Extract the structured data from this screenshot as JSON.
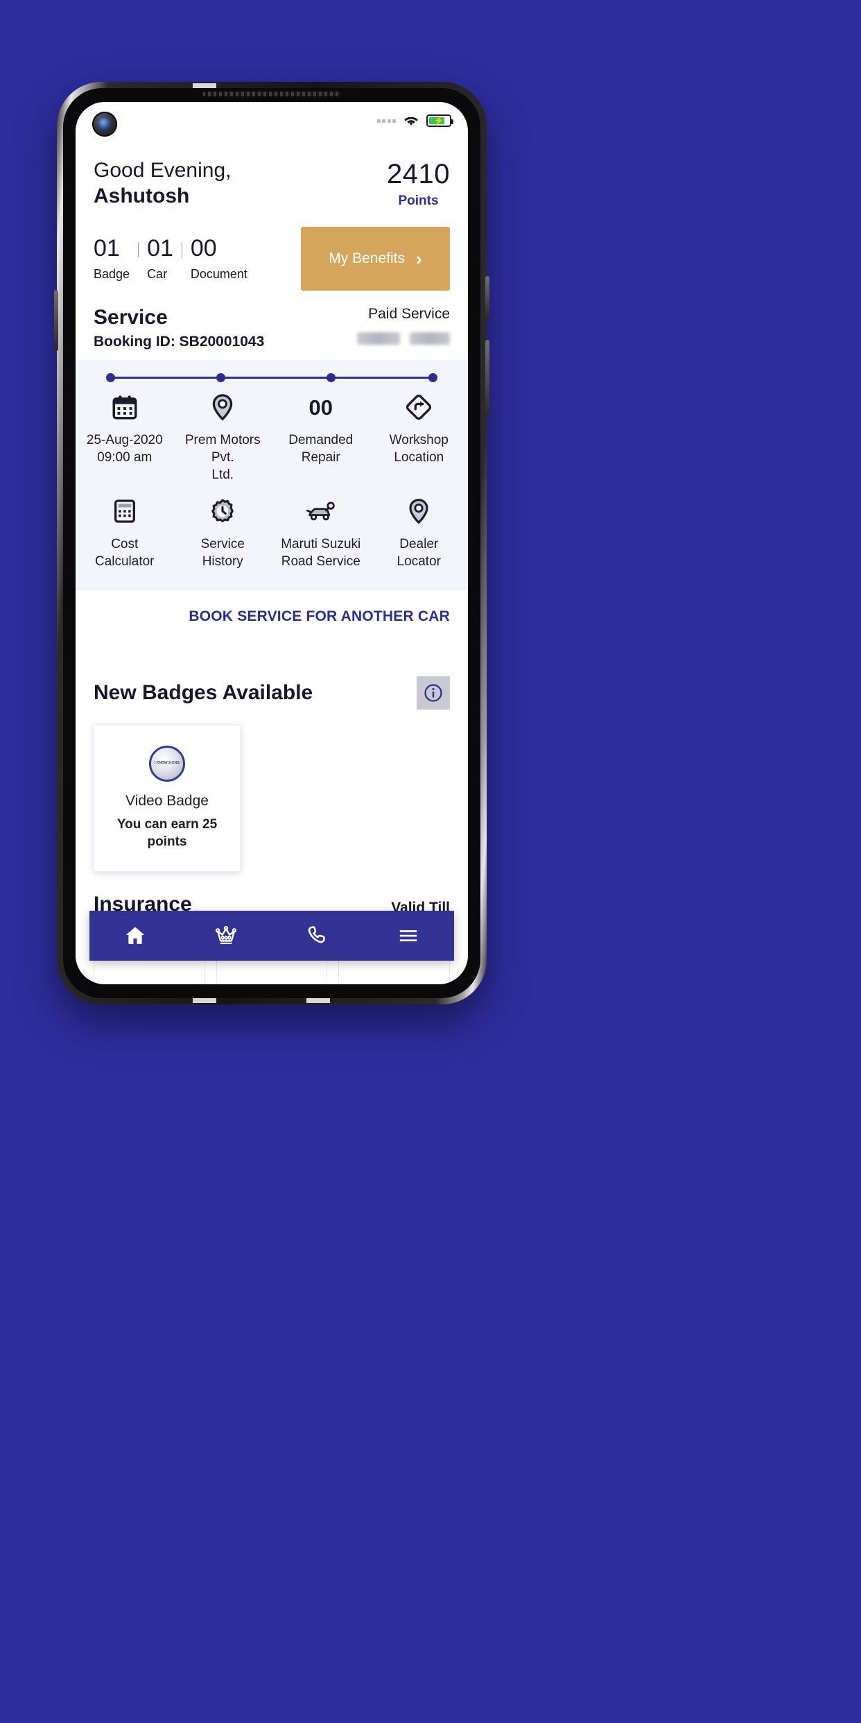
{
  "statusbar": {
    "signal_icon": "signal-dots-icon",
    "wifi_icon": "wifi-icon",
    "battery_icon": "battery-charging-icon"
  },
  "header": {
    "greeting": "Good Evening,",
    "user_name": "Ashutosh",
    "points_value": "2410",
    "points_label": "Points"
  },
  "stats": {
    "items": [
      {
        "value": "01",
        "label": "Badge"
      },
      {
        "value": "01",
        "label": "Car"
      },
      {
        "value": "00",
        "label": "Document"
      }
    ],
    "benefits_label": "My Benefits",
    "benefits_chevron": "chevron-right-icon"
  },
  "service": {
    "title": "Service",
    "booking_id": "Booking ID: SB20001043",
    "paid_label": "Paid Service",
    "timeline": [
      {
        "icon": "calendar-icon",
        "line1": "25-Aug-2020",
        "line2": "09:00 am",
        "value": ""
      },
      {
        "icon": "location-pin-icon",
        "line1": "Prem Motors Pvt.",
        "line2": "Ltd.",
        "value": ""
      },
      {
        "icon": "count-number",
        "line1": "Demanded",
        "line2": "Repair",
        "value": "00"
      },
      {
        "icon": "workshop-direction-icon",
        "line1": "Workshop",
        "line2": "Location",
        "value": ""
      }
    ],
    "actions": [
      {
        "icon": "calculator-icon",
        "line1": "Cost",
        "line2": "Calculator"
      },
      {
        "icon": "gear-clock-icon",
        "line1": "Service",
        "line2": "History"
      },
      {
        "icon": "road-service-car-icon",
        "line1": "Maruti Suzuki",
        "line2": "Road Service"
      },
      {
        "icon": "dealer-pin-icon",
        "line1": "Dealer",
        "line2": "Locator"
      }
    ],
    "book_another_label": "BOOK SERVICE FOR ANOTHER CAR"
  },
  "badges": {
    "title": "New Badges Available",
    "info_icon": "info-icon",
    "cards": [
      {
        "medal_text": "I KNOW S-CNG",
        "name": "Video Badge",
        "subtitle": "You can earn 25 points"
      }
    ]
  },
  "insurance": {
    "title": "Insurance",
    "valid_till_label": "Valid Till"
  },
  "bottom_nav": {
    "items": [
      {
        "icon": "home-icon",
        "active": true
      },
      {
        "icon": "crown-icon",
        "active": false
      },
      {
        "icon": "phone-icon",
        "active": false
      },
      {
        "icon": "menu-icon",
        "active": false
      }
    ]
  },
  "colors": {
    "page_background": "#2d2d9e",
    "brand_blue": "#2e2e8f",
    "nav_blue": "#333396",
    "accent_gold": "#d6a65c",
    "text_dark": "#16182b",
    "panel_grey": "#f4f5fb"
  }
}
